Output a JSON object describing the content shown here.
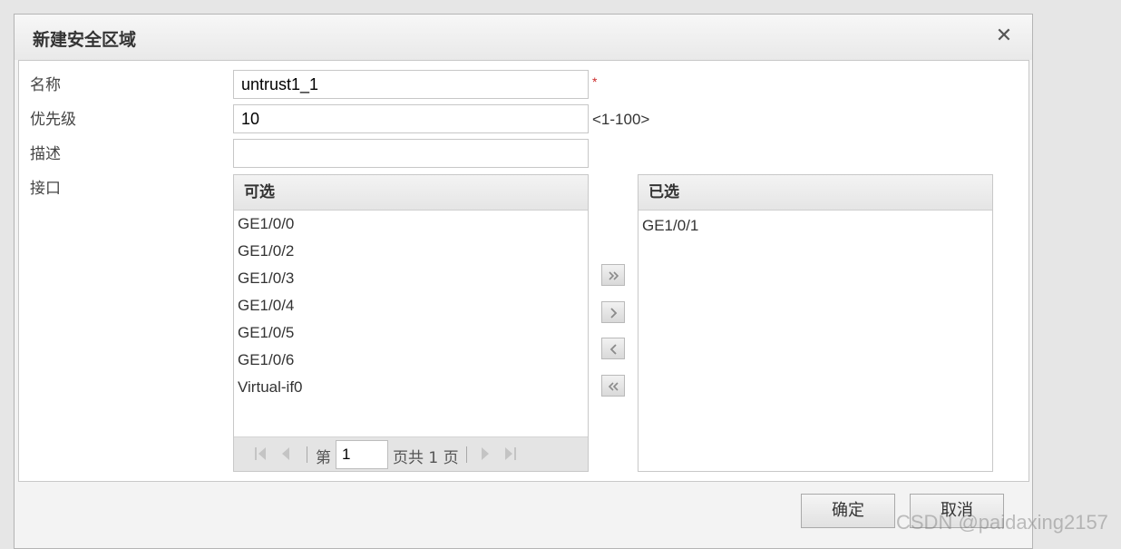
{
  "dialog": {
    "title": "新建安全区域",
    "close_glyph": "✕"
  },
  "form": {
    "name": {
      "label": "名称",
      "value": "untrust1_1",
      "required_mark": "*"
    },
    "priority": {
      "label": "优先级",
      "value": "10",
      "hint": "<1-100>"
    },
    "description": {
      "label": "描述",
      "value": ""
    },
    "interface": {
      "label": "接口"
    }
  },
  "available": {
    "header": "可选",
    "items": [
      "GE1/0/0",
      "GE1/0/2",
      "GE1/0/3",
      "GE1/0/4",
      "GE1/0/5",
      "GE1/0/6",
      "Virtual-if0"
    ]
  },
  "selected": {
    "header": "已选",
    "items": [
      "GE1/0/1"
    ]
  },
  "pager": {
    "prefix": "第",
    "page": "1",
    "suffix": "页共 1 页"
  },
  "buttons": {
    "ok": "确定",
    "cancel": "取消"
  },
  "watermark": "CSDN @paidaxing2157",
  "icons": {
    "move_all_right": "double-chevron-right-icon",
    "move_right": "chevron-right-icon",
    "move_left": "chevron-left-icon",
    "move_all_left": "double-chevron-left-icon",
    "first_page": "first-page-icon",
    "prev_page": "prev-page-icon",
    "next_page": "next-page-icon",
    "last_page": "last-page-icon"
  },
  "colors": {
    "required": "#cc2b2b",
    "pager_icon": "#c4c4c4",
    "arrow_icon": "#8a8a8a"
  }
}
